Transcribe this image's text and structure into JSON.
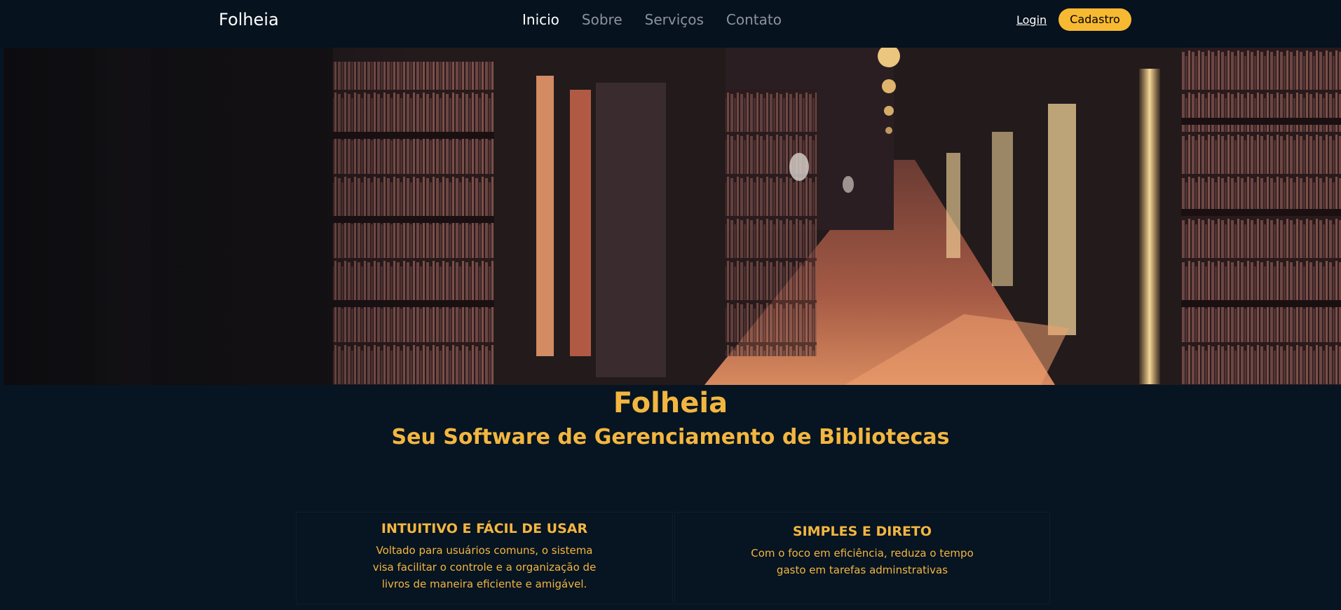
{
  "navbar": {
    "brand": "Folheia",
    "links": [
      {
        "label": "Inicio",
        "active": true
      },
      {
        "label": "Sobre",
        "active": false
      },
      {
        "label": "Serviços",
        "active": false
      },
      {
        "label": "Contato",
        "active": false
      }
    ],
    "login_label": "Login",
    "signup_label": "Cadastro"
  },
  "hero": {
    "title": "Folheia",
    "subtitle": "Seu Software de Gerenciamento de Bibliotecas"
  },
  "features": [
    {
      "title": "INTUITIVO E FÁCIL DE USAR",
      "text": "Voltado para usuários comuns, o sistema visa facilitar o controle e a organização de livros de maneira eficiente e amigável."
    },
    {
      "title": "SIMPLES E DIRETO",
      "text": "Com o foco em eficiência, reduza o tempo gasto em tarefas adminstrativas"
    }
  ],
  "colors": {
    "background": "#071421",
    "accent": "#f2b640",
    "button": "#f7b932"
  }
}
